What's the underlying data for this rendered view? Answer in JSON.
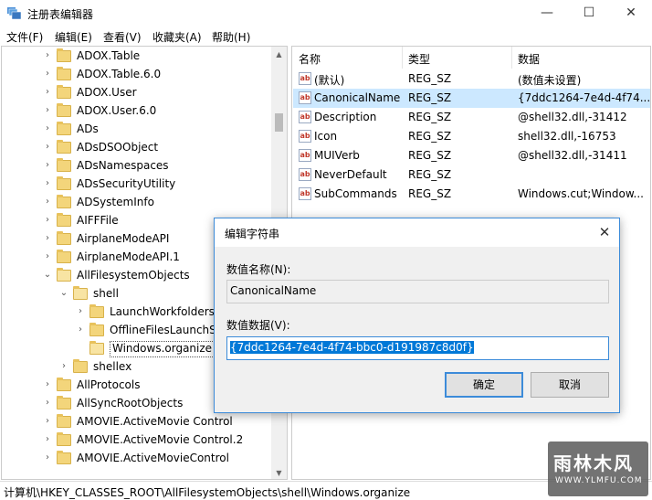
{
  "window": {
    "title": "注册表编辑器",
    "minimize_glyph": "—",
    "maximize_glyph": "☐",
    "close_glyph": "✕"
  },
  "menu": [
    "文件(F)",
    "编辑(E)",
    "查看(V)",
    "收藏夹(A)",
    "帮助(H)"
  ],
  "tree": {
    "items": [
      {
        "label": "ADOX.Table",
        "depth": 0,
        "arrow": "›"
      },
      {
        "label": "ADOX.Table.6.0",
        "depth": 0,
        "arrow": "›"
      },
      {
        "label": "ADOX.User",
        "depth": 0,
        "arrow": "›"
      },
      {
        "label": "ADOX.User.6.0",
        "depth": 0,
        "arrow": "›"
      },
      {
        "label": "ADs",
        "depth": 0,
        "arrow": "›"
      },
      {
        "label": "ADsDSOObject",
        "depth": 0,
        "arrow": "›"
      },
      {
        "label": "ADsNamespaces",
        "depth": 0,
        "arrow": "›"
      },
      {
        "label": "ADsSecurityUtility",
        "depth": 0,
        "arrow": "›"
      },
      {
        "label": "ADSystemInfo",
        "depth": 0,
        "arrow": "›"
      },
      {
        "label": "AIFFFile",
        "depth": 0,
        "arrow": "›"
      },
      {
        "label": "AirplaneModeAPI",
        "depth": 0,
        "arrow": "›"
      },
      {
        "label": "AirplaneModeAPI.1",
        "depth": 0,
        "arrow": "›"
      },
      {
        "label": "AllFilesystemObjects",
        "depth": 0,
        "arrow": "⌄"
      },
      {
        "label": "shell",
        "depth": 1,
        "arrow": "⌄"
      },
      {
        "label": "LaunchWorkfolders",
        "depth": 2,
        "arrow": "›"
      },
      {
        "label": "OfflineFilesLaunchSy",
        "depth": 2,
        "arrow": "›"
      },
      {
        "label": "Windows.organize",
        "depth": 2,
        "arrow": "",
        "selected": true
      },
      {
        "label": "shellex",
        "depth": 1,
        "arrow": "›"
      },
      {
        "label": "AllProtocols",
        "depth": 0,
        "arrow": "›"
      },
      {
        "label": "AllSyncRootObjects",
        "depth": 0,
        "arrow": "›"
      },
      {
        "label": "AMOVIE.ActiveMovie Control",
        "depth": 0,
        "arrow": "›"
      },
      {
        "label": "AMOVIE.ActiveMovie Control.2",
        "depth": 0,
        "arrow": "›"
      },
      {
        "label": "AMOVIE.ActiveMovieControl",
        "depth": 0,
        "arrow": "›"
      }
    ]
  },
  "list": {
    "headers": {
      "name": "名称",
      "type": "类型",
      "data": "数据"
    },
    "icon_text": "ab",
    "rows": [
      {
        "name": "(默认)",
        "type": "REG_SZ",
        "data": "(数值未设置)"
      },
      {
        "name": "CanonicalName",
        "type": "REG_SZ",
        "data": "{7ddc1264-7e4d-4f74...",
        "selected": true
      },
      {
        "name": "Description",
        "type": "REG_SZ",
        "data": "@shell32.dll,-31412"
      },
      {
        "name": "Icon",
        "type": "REG_SZ",
        "data": "shell32.dll,-16753"
      },
      {
        "name": "MUIVerb",
        "type": "REG_SZ",
        "data": "@shell32.dll,-31411"
      },
      {
        "name": "NeverDefault",
        "type": "REG_SZ",
        "data": ""
      },
      {
        "name": "SubCommands",
        "type": "REG_SZ",
        "data": "Windows.cut;Window..."
      }
    ]
  },
  "dialog": {
    "title": "编辑字符串",
    "close_glyph": "✕",
    "name_label": "数值名称(N):",
    "name_value": "CanonicalName",
    "data_label": "数值数据(V):",
    "data_value": "{7ddc1264-7e4d-4f74-bbc0-d191987c8d0f}",
    "ok_label": "确定",
    "cancel_label": "取消"
  },
  "status": {
    "path": "计算机\\HKEY_CLASSES_ROOT\\AllFilesystemObjects\\shell\\Windows.organize"
  },
  "watermark": {
    "text": "雨林木风",
    "url": "WWW.YLMFU.COM"
  }
}
